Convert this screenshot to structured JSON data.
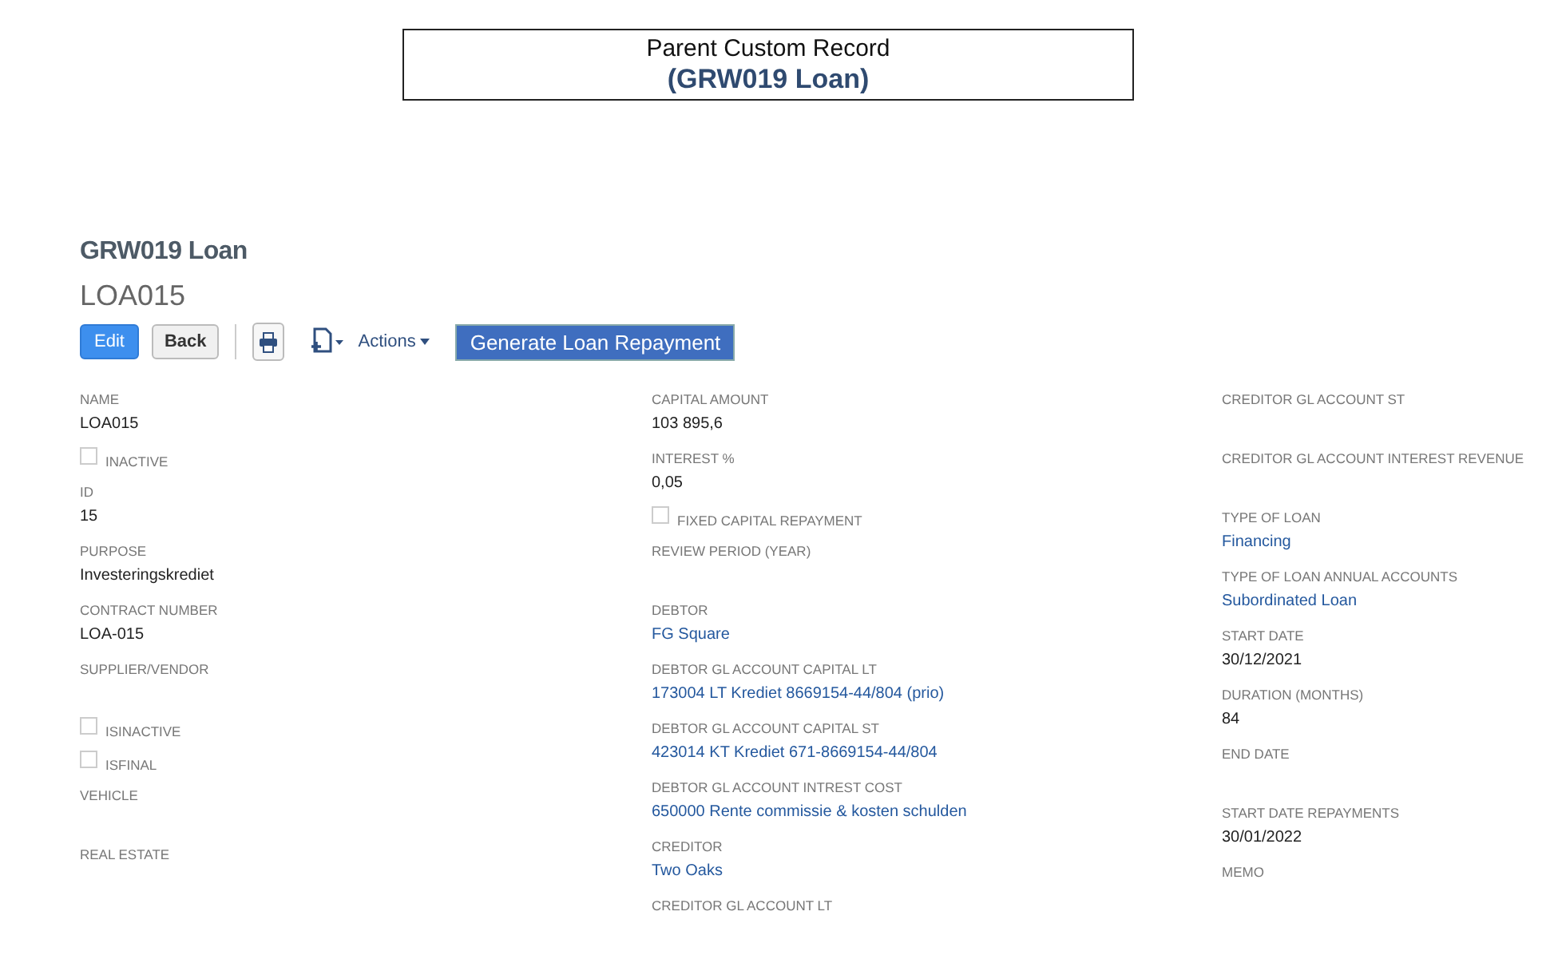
{
  "banner": {
    "line_1": "Parent Custom Record",
    "line_2": "(GRW019 Loan)"
  },
  "record": {
    "type": "GRW019 Loan",
    "name": "LOA015"
  },
  "toolbar": {
    "edit": "Edit",
    "back": "Back",
    "actions": "Actions",
    "generate": "Generate Loan Repayment"
  },
  "columns": [
    [
      {
        "kind": "field",
        "label": "NAME",
        "value": "LOA015",
        "link": false
      },
      {
        "kind": "checkbox",
        "label": "INACTIVE",
        "checked": false
      },
      {
        "kind": "field",
        "label": "ID",
        "value": "15",
        "link": false
      },
      {
        "kind": "field",
        "label": "PURPOSE",
        "value": "Investeringskrediet",
        "link": false
      },
      {
        "kind": "field",
        "label": "CONTRACT NUMBER",
        "value": "LOA-015",
        "link": false
      },
      {
        "kind": "field",
        "label": "SUPPLIER/VENDOR"
      },
      {
        "kind": "checkbox",
        "label": "ISINACTIVE",
        "checked": false
      },
      {
        "kind": "checkbox",
        "label": "ISFINAL",
        "checked": false
      },
      {
        "kind": "field",
        "label": "VEHICLE"
      },
      {
        "kind": "field",
        "label": "REAL ESTATE"
      }
    ],
    [
      {
        "kind": "field",
        "label": "CAPITAL AMOUNT",
        "value": "103 895,6",
        "link": false
      },
      {
        "kind": "field",
        "label": "INTEREST %",
        "value": "0,05",
        "link": false
      },
      {
        "kind": "checkbox",
        "label": "FIXED CAPITAL REPAYMENT",
        "checked": false
      },
      {
        "kind": "field",
        "label": "REVIEW PERIOD (YEAR)"
      },
      {
        "kind": "field",
        "label": "DEBTOR",
        "value": "FG Square",
        "link": true
      },
      {
        "kind": "field",
        "label": "DEBTOR GL ACCOUNT CAPITAL LT",
        "value": "173004 LT Krediet 8669154-44/804 (prio)",
        "link": true
      },
      {
        "kind": "field",
        "label": "DEBTOR GL ACCOUNT CAPITAL ST",
        "value": "423014 KT Krediet 671-8669154-44/804",
        "link": true
      },
      {
        "kind": "field",
        "label": "DEBTOR GL ACCOUNT INTREST COST",
        "value": "650000 Rente commissie & kosten schulden",
        "link": true
      },
      {
        "kind": "field",
        "label": "CREDITOR",
        "value": "Two Oaks",
        "link": true
      },
      {
        "kind": "field",
        "label": "CREDITOR GL ACCOUNT LT"
      }
    ],
    [
      {
        "kind": "field",
        "label": "CREDITOR GL ACCOUNT ST"
      },
      {
        "kind": "field",
        "label": "CREDITOR GL ACCOUNT INTEREST REVENUE"
      },
      {
        "kind": "field",
        "label": "TYPE OF LOAN",
        "value": "Financing",
        "link": true
      },
      {
        "kind": "field",
        "label": "TYPE OF LOAN ANNUAL ACCOUNTS",
        "value": "Subordinated Loan",
        "link": true
      },
      {
        "kind": "field",
        "label": "START DATE",
        "value": "30/12/2021",
        "link": false
      },
      {
        "kind": "field",
        "label": "DURATION (MONTHS)",
        "value": "84",
        "link": false
      },
      {
        "kind": "field",
        "label": "END DATE"
      },
      {
        "kind": "field",
        "label": "START DATE REPAYMENTS",
        "value": "30/01/2022",
        "link": false
      },
      {
        "kind": "field",
        "label": "MEMO"
      }
    ]
  ]
}
